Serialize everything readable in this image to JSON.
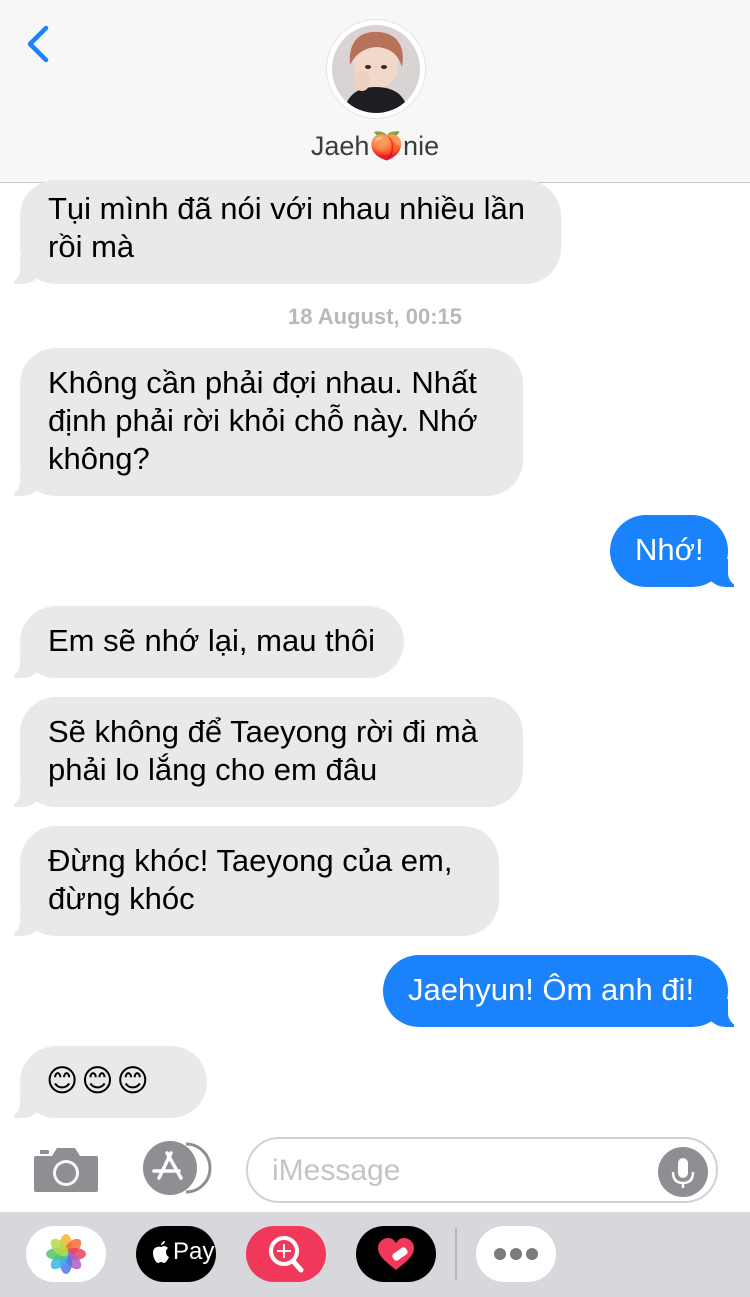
{
  "header": {
    "contact_name": "Jaeh🍑nie"
  },
  "messages": [
    {
      "side": "in",
      "text_line1": "Tụi mình đã nói với nhau nhiều lần",
      "text_line2": "rồi mà"
    },
    {
      "side": "in",
      "text_line1": "Không cần phải đợi nhau. Nhất",
      "text_line2": "định phải rời khỏi chỗ này. Nhớ",
      "text_line3": "không?"
    },
    {
      "side": "out",
      "text": "Nhớ!"
    },
    {
      "side": "in",
      "text": "Em sẽ nhớ lại, mau thôi"
    },
    {
      "side": "in",
      "text_line1": "Sẽ không để Taeyong rời đi mà",
      "text_line2": "phải lo lắng cho em đâu"
    },
    {
      "side": "in",
      "text_line1": "Đừng khóc! Taeyong của em,",
      "text_line2": "đừng khóc"
    },
    {
      "side": "out",
      "text": "Jaehyun! Ôm anh đi!"
    },
    {
      "side": "in",
      "text": "😊😊😊"
    }
  ],
  "timestamp": "18 August, 00:15",
  "input": {
    "placeholder": "iMessage",
    "value": ""
  },
  "apps": {
    "pay_label": "Pay"
  },
  "colors": {
    "incoming_bubble": "#e9e9eb",
    "outgoing_bubble": "#1a82fb",
    "accent": "#1a82fb"
  },
  "icons": [
    "back-chevron-icon",
    "camera-icon",
    "app-store-icon",
    "microphone-icon",
    "photos-app-icon",
    "apple-pay-icon",
    "image-search-icon",
    "digital-touch-icon",
    "more-apps-icon"
  ]
}
